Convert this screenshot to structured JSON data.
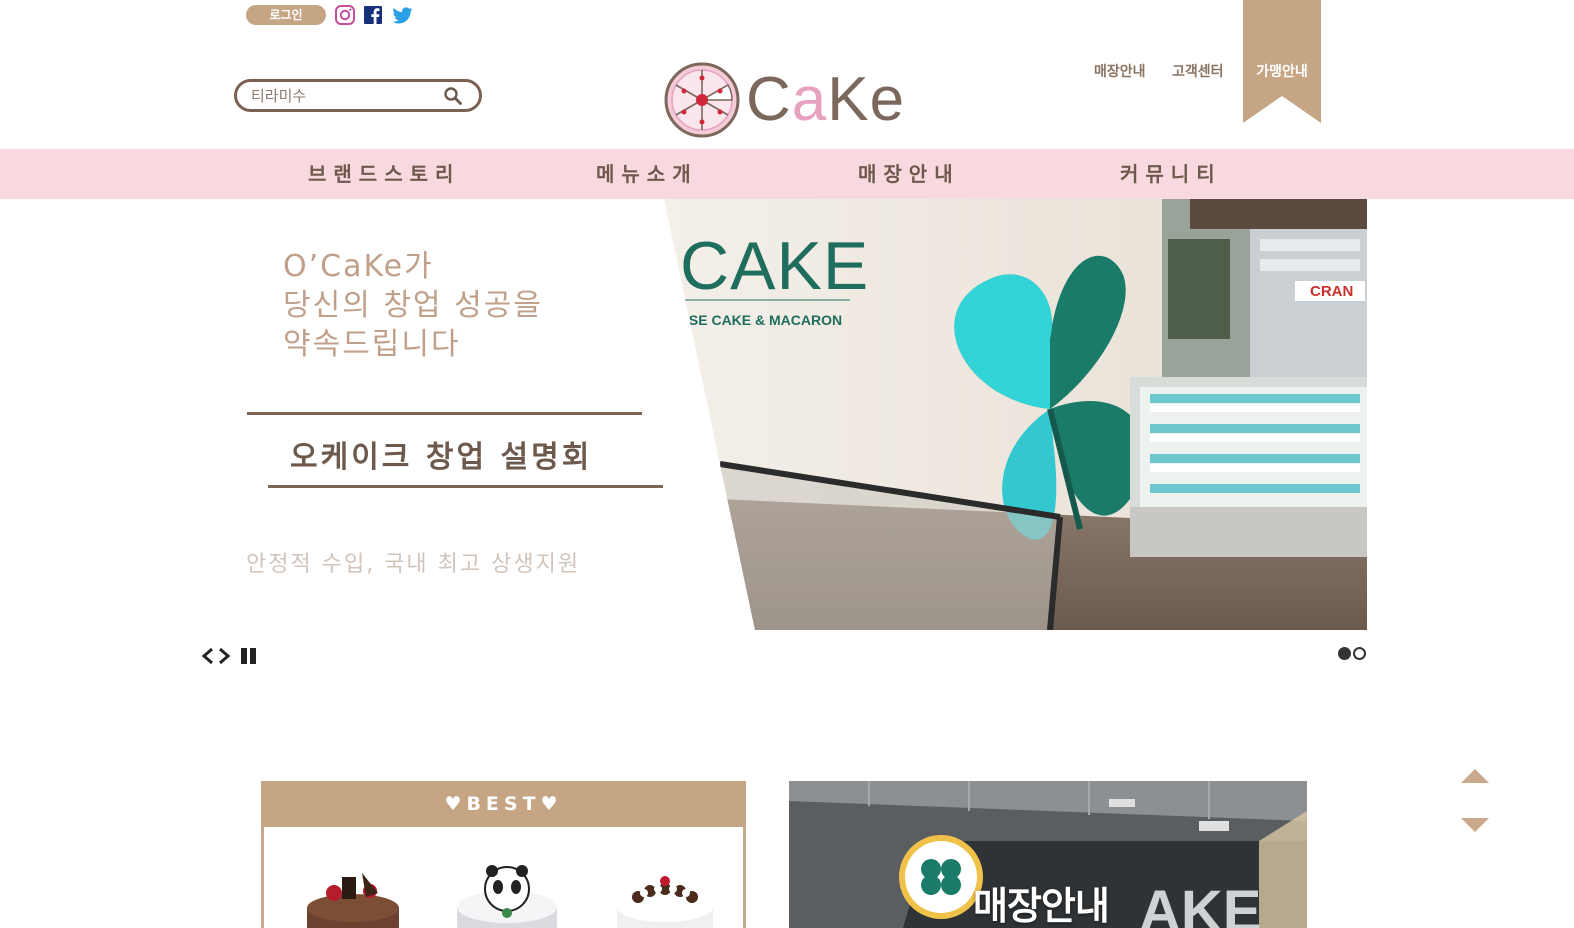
{
  "colors": {
    "accent_brown": "#c6a585",
    "dark_brown": "#7b6152",
    "nav_pink": "#f8d9df",
    "logo_pink": "#e7a2c0"
  },
  "topbar": {
    "login_label": "로그인",
    "sns_icons": [
      "instagram-icon",
      "facebook-icon",
      "twitter-icon"
    ]
  },
  "search": {
    "value": "티라미수",
    "icon": "search-icon"
  },
  "logo": {
    "prefix": "C",
    "middle": "a",
    "suffix": "Ke"
  },
  "util_links": {
    "store": "매장안내",
    "cs": "고객센터",
    "franchise": "가맹안내"
  },
  "nav": {
    "items": [
      "브랜드스토리",
      "메뉴소개",
      "매장안내",
      "커뮤니티"
    ]
  },
  "hero": {
    "headline": "O’CaKe가\n당신의 창업 성공을\n약속드립니다",
    "event_title": "오케이크 창업 설명회",
    "subtext": "안정적 수입, 국내 최고 상생지원",
    "photo_sign": "CAKE",
    "photo_sign_sub": "ISE CAKE & MACARON",
    "photo_shop_sign": "CRAN",
    "total_slides": 2,
    "active_slide": 1
  },
  "best": {
    "title": "♥BEST♥"
  },
  "store_banner": {
    "title": "매장안내",
    "sign_text": "AKE"
  }
}
